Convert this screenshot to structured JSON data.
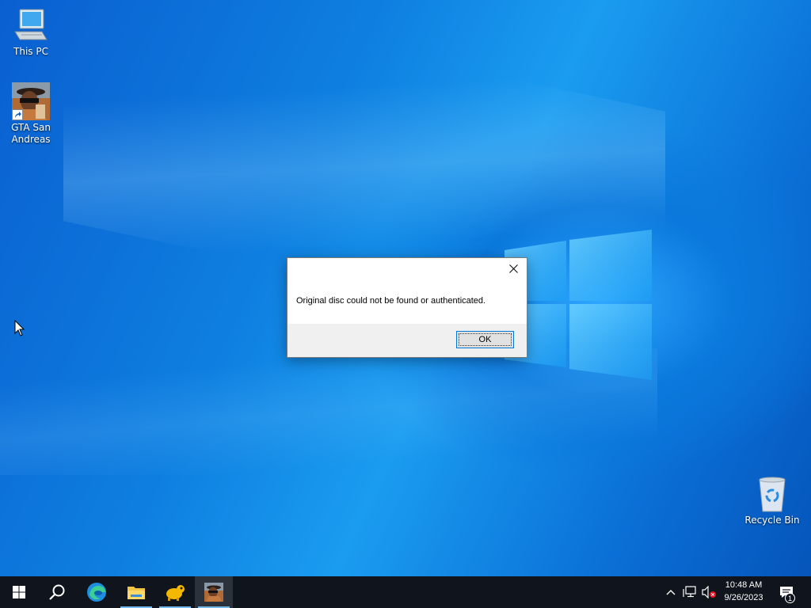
{
  "desktop": {
    "icons": [
      {
        "label": "This PC",
        "icon": "computer-icon"
      },
      {
        "label": "GTA San Andreas",
        "icon": "gta-sa-icon"
      },
      {
        "label": "Recycle Bin",
        "icon": "recycle-bin-icon"
      }
    ]
  },
  "dialog": {
    "title": "",
    "message": "Original disc could not be found or authenticated.",
    "ok_label": "OK"
  },
  "taskbar": {
    "apps": [
      {
        "name": "Start",
        "icon": "windows-start-icon"
      },
      {
        "name": "Search",
        "icon": "search-icon"
      },
      {
        "name": "Microsoft Edge",
        "icon": "edge-icon"
      },
      {
        "name": "File Explorer",
        "icon": "folder-icon"
      },
      {
        "name": "Game launcher",
        "icon": "yellow-app-icon"
      },
      {
        "name": "GTA San Andreas",
        "icon": "gta-sa-icon"
      }
    ],
    "tray": {
      "time": "10:48 AM",
      "date": "9/26/2023",
      "notification_count": "1"
    }
  },
  "colors": {
    "taskbar_bg": "#10151d",
    "accent": "#0078d7",
    "desktop_blue": "#0a78dc"
  }
}
